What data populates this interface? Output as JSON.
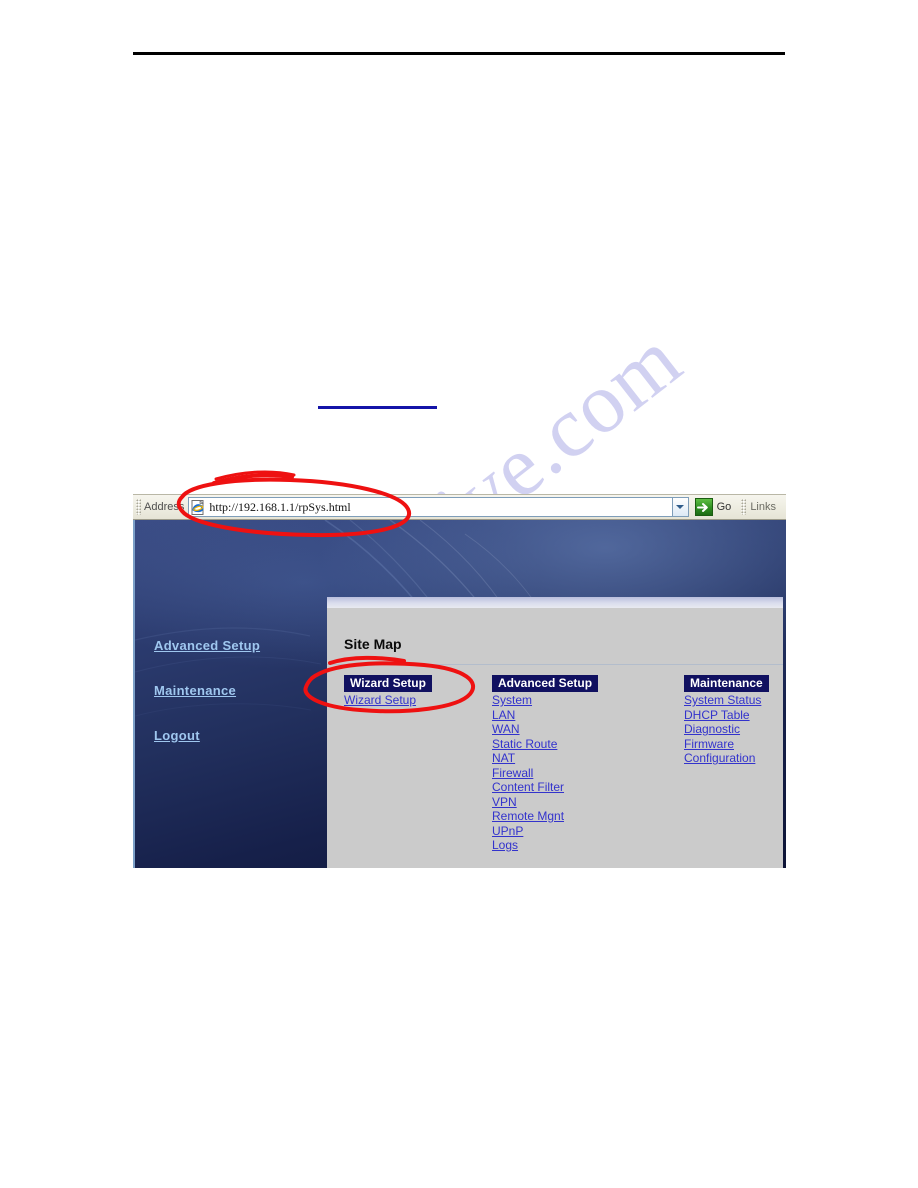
{
  "document": {
    "watermark": "manualshive.com"
  },
  "browser": {
    "address_bar": {
      "label": "Address",
      "url": "http://192.168.1.1/rpSys.html",
      "placeholder": "http://",
      "go_label": "Go",
      "links_label": "Links",
      "icons": {
        "page": "ie-page-icon",
        "dropdown": "chevron-down-icon",
        "go": "go-arrow-icon"
      }
    }
  },
  "router_ui": {
    "sidebar": {
      "items": [
        {
          "label": "Advanced Setup"
        },
        {
          "label": "Maintenance"
        },
        {
          "label": "Logout"
        }
      ]
    },
    "panel": {
      "title": "Site Map",
      "columns": [
        {
          "heading": "Wizard Setup",
          "links": [
            {
              "label": "Wizard Setup"
            }
          ]
        },
        {
          "heading": "Advanced Setup",
          "links": [
            {
              "label": "System"
            },
            {
              "label": "LAN"
            },
            {
              "label": "WAN"
            },
            {
              "label": "Static Route"
            },
            {
              "label": "NAT"
            },
            {
              "label": "Firewall"
            },
            {
              "label": "Content Filter"
            },
            {
              "label": "VPN"
            },
            {
              "label": "Remote Mgnt"
            },
            {
              "label": "UPnP"
            },
            {
              "label": "Logs"
            }
          ]
        },
        {
          "heading": "Maintenance",
          "links": [
            {
              "label": "System Status"
            },
            {
              "label": "DHCP Table"
            },
            {
              "label": "Diagnostic"
            },
            {
              "label": "Firmware"
            },
            {
              "label": "Configuration"
            }
          ]
        }
      ]
    }
  },
  "annotations": {
    "color": "#ee1111",
    "shapes": [
      {
        "name": "url-highlight-ellipse"
      },
      {
        "name": "url-leader-line"
      },
      {
        "name": "wizard-setup-highlight-ellipse"
      },
      {
        "name": "site-map-underline-stroke"
      }
    ]
  },
  "colors": {
    "link_blue": "#3333cc",
    "header_navy": "#101060",
    "sidebar_link": "#9fc7ef",
    "panel_gray": "#cbcbcb",
    "annotation_red": "#ee1111",
    "watermark_lavender": "#c9c9ef"
  }
}
